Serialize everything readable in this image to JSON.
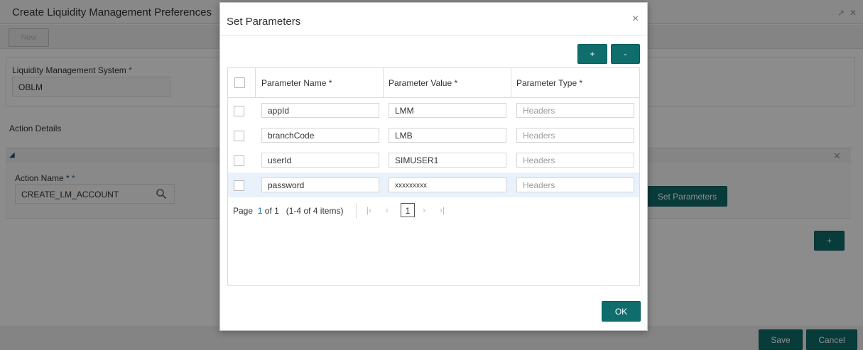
{
  "background": {
    "page_title": "Create Liquidity Management Preferences",
    "toolbar": {
      "new_label": "New"
    },
    "lms_label": "Liquidity Management System",
    "lms_value": "OBLM",
    "action_details_title": "Action Details",
    "action_name_label": "Action Name *",
    "action_name_value": "CREATE_LM_ACCOUNT",
    "set_parameters_label": "Set Parameters",
    "add_label": "+",
    "save_label": "Save",
    "cancel_label": "Cancel",
    "required_mark": "*"
  },
  "modal": {
    "title": "Set Parameters",
    "close_glyph": "×",
    "add_label": "+",
    "remove_label": "-",
    "columns": [
      "Parameter Name *",
      "Parameter Value *",
      "Parameter Type *"
    ],
    "rows": [
      {
        "name": "appId",
        "value": "LMM",
        "type": "Headers"
      },
      {
        "name": "branchCode",
        "value": "LMB",
        "type": "Headers"
      },
      {
        "name": "userId",
        "value": "SIMUSER1",
        "type": "Headers"
      },
      {
        "name": "password",
        "value": "xxxxxxxxx",
        "type": "Headers"
      }
    ],
    "pager": {
      "page_word": "Page",
      "current": "1",
      "of_text": "of 1",
      "items_text": "(1-4 of 4 items)",
      "page_box": "1"
    },
    "ok_label": "OK"
  },
  "colors": {
    "teal_button": "#0f6e6c",
    "highlight_row": "#e9f2fb",
    "required_star": "#1c6db8"
  }
}
